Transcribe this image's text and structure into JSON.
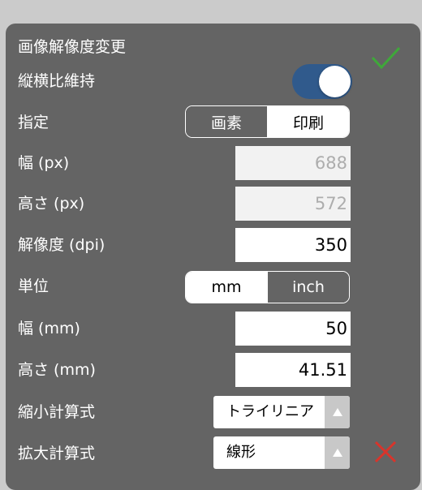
{
  "title": "画像解像度変更",
  "aspect": {
    "label": "縦横比維持",
    "on": true
  },
  "mode": {
    "label": "指定",
    "options": [
      "画素",
      "印刷"
    ],
    "selected": "画素"
  },
  "width_px": {
    "label": "幅 (px)",
    "value": "688"
  },
  "height_px": {
    "label": "高さ (px)",
    "value": "572"
  },
  "resolution": {
    "label": "解像度 (dpi)",
    "value": "350"
  },
  "unit": {
    "label": "単位",
    "options": [
      "mm",
      "inch"
    ],
    "selected": "inch"
  },
  "width_mm": {
    "label": "幅 (mm)",
    "value": "50"
  },
  "height_mm": {
    "label": "高さ (mm)",
    "value": "41.51"
  },
  "shrink": {
    "label": "縮小計算式",
    "value": "トライリニア"
  },
  "enlarge": {
    "label": "拡大計算式",
    "value": "線形"
  },
  "icons": {
    "confirm": "check-icon",
    "cancel": "close-icon",
    "dropdown": "triangle-up-icon"
  },
  "colors": {
    "confirm": "#3fa83a",
    "cancel": "#d9342b",
    "toggle_on": "#305a8c",
    "panel": "#646464"
  }
}
